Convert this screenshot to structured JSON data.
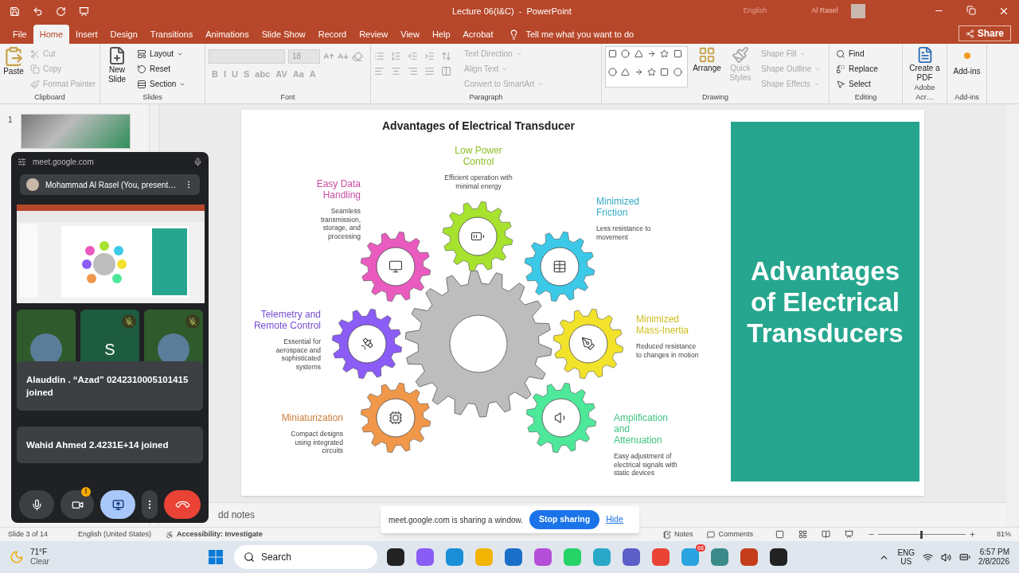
{
  "window": {
    "title": "Lecture 06(I&C)  -  PowerPoint",
    "overlay_language": "English",
    "overlay_user": "Al Rasel"
  },
  "menu_tabs": [
    {
      "label": "File",
      "selected": false
    },
    {
      "label": "Home",
      "selected": true
    },
    {
      "label": "Insert",
      "selected": false
    },
    {
      "label": "Design",
      "selected": false
    },
    {
      "label": "Transitions",
      "selected": false
    },
    {
      "label": "Animations",
      "selected": false
    },
    {
      "label": "Slide Show",
      "selected": false
    },
    {
      "label": "Record",
      "selected": false
    },
    {
      "label": "Review",
      "selected": false
    },
    {
      "label": "View",
      "selected": false
    },
    {
      "label": "Help",
      "selected": false
    },
    {
      "label": "Acrobat",
      "selected": false
    }
  ],
  "tell_me": "Tell me what you want to do",
  "share": "Share",
  "ribbon": {
    "clipboard": {
      "label": "Clipboard",
      "paste": "Paste",
      "items": [
        {
          "label": "Cut",
          "disabled": true
        },
        {
          "label": "Copy",
          "disabled": true
        },
        {
          "label": "Format Painter",
          "disabled": true
        }
      ]
    },
    "slides": {
      "label": "Slides",
      "new_slide": "New Slide",
      "items": [
        {
          "label": "Layout"
        },
        {
          "label": "Reset"
        },
        {
          "label": "Section"
        }
      ]
    },
    "font": {
      "label": "Font",
      "size": "18",
      "buttons": [
        "B",
        "I",
        "U",
        "S",
        "abc",
        "AV",
        "Aa",
        "A"
      ]
    },
    "paragraph": {
      "label": "Paragraph",
      "items": [
        {
          "label": "Text Direction",
          "disabled": true
        },
        {
          "label": "Align Text",
          "disabled": true
        },
        {
          "label": "Convert to SmartArt",
          "disabled": true
        }
      ]
    },
    "drawing": {
      "label": "Drawing",
      "arrange": "Arrange",
      "quick_styles": "Quick Styles",
      "items": [
        {
          "label": "Shape Fill",
          "disabled": true
        },
        {
          "label": "Shape Outline",
          "disabled": true
        },
        {
          "label": "Shape Effects",
          "disabled": true
        }
      ]
    },
    "editing": {
      "label": "Editing",
      "items": [
        "Find",
        "Replace",
        "Select"
      ]
    },
    "adobe": {
      "label": "Adobe Acr…",
      "button": "Create a PDF"
    },
    "addins": {
      "label": "Add-ins",
      "button": "Add-ins"
    }
  },
  "thumbnails": [
    {
      "number": "1"
    }
  ],
  "slide": {
    "title": "Advantages of Electrical Transducer",
    "panel_title": "Advantages of Electrical Transducers",
    "items": [
      {
        "title": "Low Power Control",
        "description": "Efficient operation with minimal energy",
        "color": "#a6e22e"
      },
      {
        "title": "Easy Data Handling",
        "description": "Seamless transmission, storage, and processing",
        "color": "#e95bbf"
      },
      {
        "title": "Minimized Friction",
        "description": "Less resistance to movement",
        "color": "#3cc9e8"
      },
      {
        "title": "Telemetry and Remote Control",
        "description": "Essential for aerospace and sophisticated systems",
        "color": "#8b5cf6"
      },
      {
        "title": "Minimized Mass-Inertia",
        "description": "Reduced resistance to changes in motion",
        "color": "#f2e22a"
      },
      {
        "title": "Miniaturization",
        "description": "Compact designs using integrated circuits",
        "color": "#f0974a"
      },
      {
        "title": "Amplification and Attenuation",
        "description": "Easy adjustment of electrical signals with static devices",
        "color": "#4ee89a"
      }
    ]
  },
  "notes": "dd notes",
  "status_bar": {
    "slide": "Slide 3 of 14",
    "language": "English (United States)",
    "accessibility": "Accessibility: Investigate",
    "notes": "Notes",
    "comments": "Comments",
    "zoom": "81%",
    "zoom_slider": {
      "level": 0.49
    }
  },
  "meet": {
    "url": "meet.google.com",
    "presenter": "Mohammad Al Rasel (You, present…",
    "tiles": [
      {
        "kind": "photo",
        "muted": false
      },
      {
        "kind": "letter",
        "letter": "S",
        "muted": true
      },
      {
        "kind": "photo",
        "muted": true
      }
    ],
    "notifications": [
      "Alauddin . “Azad” 0242310005101415 joined",
      "Wahid Ahmed 2.4231E+14 joined"
    ],
    "camera_warning": "!",
    "presenting": true
  },
  "share_bar": {
    "message": "meet.google.com is sharing a window.",
    "stop": "Stop sharing",
    "hide": "Hide"
  },
  "taskbar": {
    "temperature": "71°F",
    "weather": "Clear",
    "search": "Search",
    "badge": "68",
    "language": "ENG",
    "region": "US",
    "time": "6:57 PM",
    "date": "2/8/2026"
  }
}
